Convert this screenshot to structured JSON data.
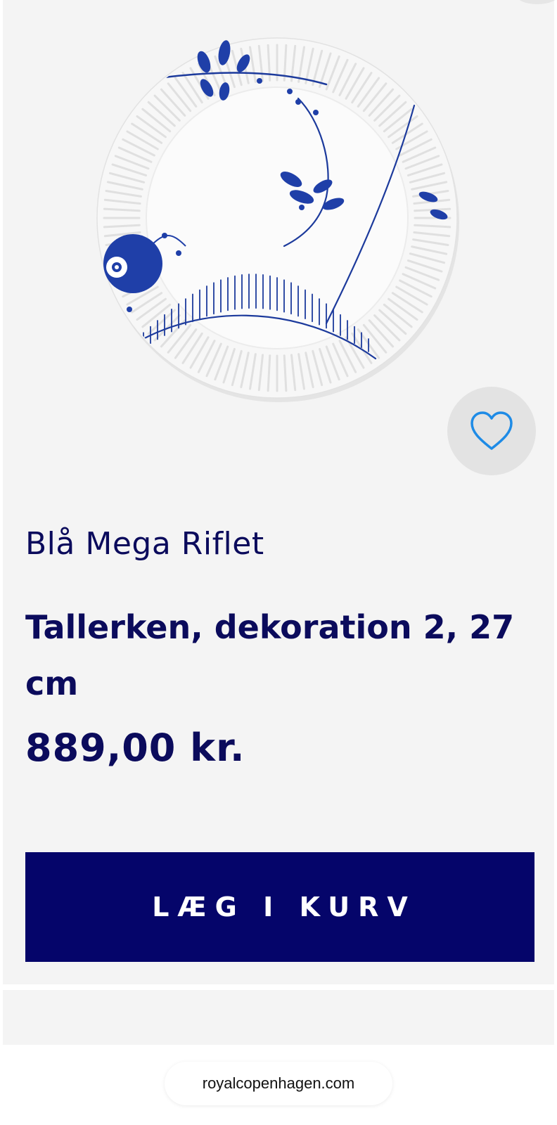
{
  "product": {
    "brand": "Blå Mega Riflet",
    "name": "Tallerken, dekoration 2, 27 cm",
    "price": "889,00 kr."
  },
  "actions": {
    "add_to_cart_label": "LÆG I KURV",
    "wishlist_icon": "heart-outline-icon"
  },
  "browser": {
    "url": "royalcopenhagen.com"
  },
  "colors": {
    "brand_navy": "#05056a",
    "text_navy": "#0b0b5c",
    "heart_blue": "#1e8be6",
    "card_background": "#f4f4f4"
  }
}
